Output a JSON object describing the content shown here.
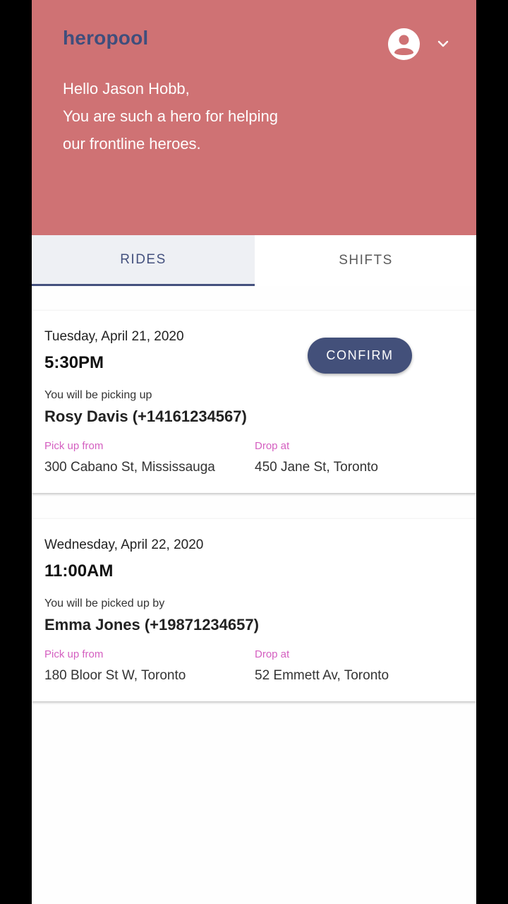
{
  "app": {
    "brand": "heropool"
  },
  "header": {
    "greeting_lines": [
      "Hello Jason Hobb,",
      "You are such a hero for helping",
      "our frontline heroes."
    ],
    "icons": {
      "account": "account-circle-icon",
      "menu": "chevron-down-icon"
    }
  },
  "colors": {
    "header_bg": "#cf7274",
    "accent": "#43507a",
    "label_pink": "#d45fc0"
  },
  "tabs": [
    {
      "label": "RIDES",
      "active": true
    },
    {
      "label": "SHIFTS",
      "active": false
    }
  ],
  "rides": [
    {
      "date": "Tuesday, April 21, 2020",
      "time": "5:30PM",
      "role": "You will be picking up",
      "person": "Rosy Davis (+14161234567)",
      "pickup_label": "Pick up from",
      "pickup": "300 Cabano St, Mississauga",
      "dropoff_label": "Drop at",
      "dropoff": "450 Jane St, Toronto",
      "action": "CONFIRM"
    },
    {
      "date": "Wednesday, April 22, 2020",
      "time": "11:00AM",
      "role": "You will be picked up by",
      "person": "Emma Jones (+19871234657)",
      "pickup_label": "Pick up from",
      "pickup": "180 Bloor St W, Toronto",
      "dropoff_label": "Drop at",
      "dropoff": "52 Emmett Av, Toronto"
    }
  ]
}
